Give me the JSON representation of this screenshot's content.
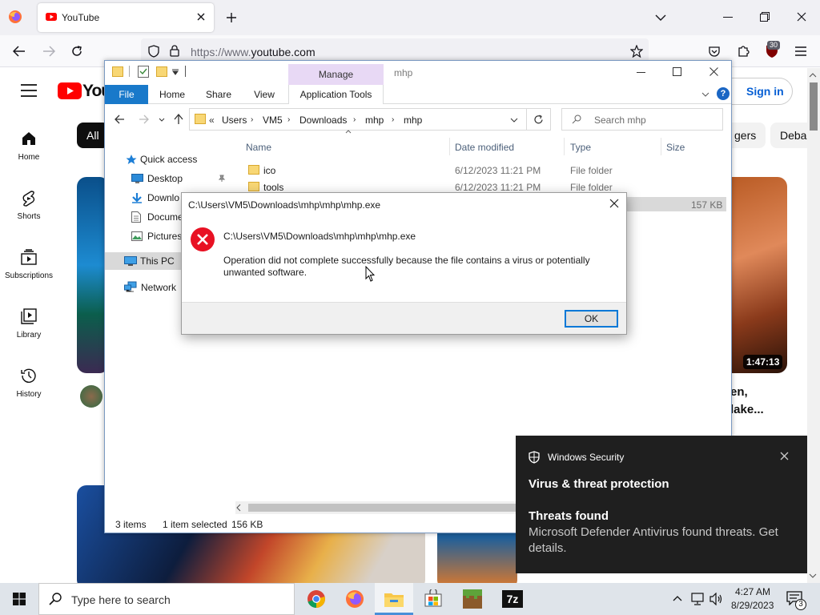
{
  "browser": {
    "tab_title": "YouTube",
    "url_prefix": "https://www.",
    "url_host": "youtube.com",
    "extension_badge": "30"
  },
  "youtube": {
    "logo_text": "You",
    "sign_in": "Sign in",
    "nav": [
      {
        "label": "Home"
      },
      {
        "label": "Shorts"
      },
      {
        "label": "Subscriptions"
      },
      {
        "label": "Library"
      },
      {
        "label": "History"
      }
    ],
    "chips": [
      {
        "label": "All"
      },
      {
        "label": "gers"
      },
      {
        "label": "Deba"
      }
    ],
    "video_duration": "1:47:13",
    "video_title_lines": [
      "en,",
      "lake..."
    ]
  },
  "explorer": {
    "title": "mhp",
    "manage_tab": "Manage",
    "ribbon_tabs": [
      {
        "label": "File"
      },
      {
        "label": "Home"
      },
      {
        "label": "Share"
      },
      {
        "label": "View"
      },
      {
        "label": "Application Tools"
      }
    ],
    "breadcrumb": [
      {
        "label": "Users"
      },
      {
        "label": "VM5"
      },
      {
        "label": "Downloads"
      },
      {
        "label": "mhp"
      },
      {
        "label": "mhp"
      }
    ],
    "search_placeholder": "Search mhp",
    "nav_pane": [
      {
        "label": "Quick access"
      },
      {
        "label": "Desktop"
      },
      {
        "label": "Downlo"
      },
      {
        "label": "Docume"
      },
      {
        "label": "Pictures"
      },
      {
        "label": "This PC"
      },
      {
        "label": "Network"
      }
    ],
    "columns": {
      "name": "Name",
      "date": "Date modified",
      "type": "Type",
      "size": "Size"
    },
    "files": [
      {
        "name": "ico",
        "date": "6/12/2023 11:21 PM",
        "type": "File folder",
        "size": ""
      },
      {
        "name": "tools",
        "date": "6/12/2023 11:21 PM",
        "type": "File folder",
        "size": ""
      },
      {
        "name": "",
        "date": "",
        "type": "",
        "size": "157 KB"
      }
    ],
    "status_items": "3 items",
    "status_selected": "1 item selected",
    "status_size": "156 KB"
  },
  "dialog": {
    "title": "C:\\Users\\VM5\\Downloads\\mhp\\mhp\\mhp.exe",
    "path": "C:\\Users\\VM5\\Downloads\\mhp\\mhp\\mhp.exe",
    "message_line1": "Operation did not complete successfully because the file contains a virus or potentially",
    "message_line2": "unwanted software.",
    "ok": "OK"
  },
  "toast": {
    "app": "Windows Security",
    "heading": "Virus & threat protection",
    "subheading": "Threats found",
    "body_line1": "Microsoft Defender Antivirus found threats. Get",
    "body_line2": "details."
  },
  "taskbar": {
    "search_placeholder": "Type here to search",
    "time": "4:27 AM",
    "date": "8/29/2023",
    "notification_count": "3",
    "app_7z": "7z"
  },
  "colors": {
    "yt_red": "#ff0000",
    "link_blue": "#065fd4",
    "error_red": "#e81123",
    "accent": "#0078d7",
    "manage_purple": "#e8d9f5"
  }
}
